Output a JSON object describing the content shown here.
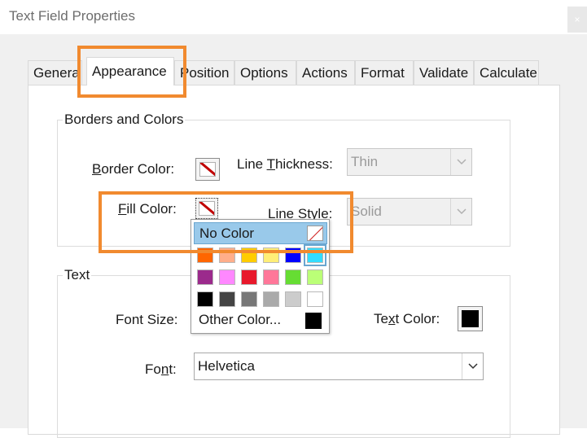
{
  "window": {
    "title": "Text Field Properties",
    "close_glyph": "×"
  },
  "tabs": [
    {
      "label": "General",
      "visible_text": "Genera"
    },
    {
      "label": "Appearance",
      "active": true
    },
    {
      "label": "Position"
    },
    {
      "label": "Options"
    },
    {
      "label": "Actions"
    },
    {
      "label": "Format"
    },
    {
      "label": "Validate"
    },
    {
      "label": "Calculate"
    }
  ],
  "borders_colors": {
    "group_label": "Borders and Colors",
    "border_color": {
      "mnemonic": "B",
      "rest": "order Color:"
    },
    "line_thickness": {
      "before": "Line ",
      "mnemonic": "T",
      "rest": "hickness:",
      "value": "Thin"
    },
    "fill_color": {
      "mnemonic": "F",
      "rest": "ill Color:"
    },
    "line_style": {
      "label": "Line Style:",
      "value": "Solid"
    }
  },
  "color_picker": {
    "no_color_label": "No Color",
    "other_color_label": "Other Color...",
    "other_color_swatch": "#000000",
    "colors": [
      [
        "#ff6600",
        "#ffae8a",
        "#ffcc00",
        "#ffee77",
        "#0000ff",
        "#33ddff"
      ],
      [
        "#9b2a8c",
        "#ff88ff",
        "#e8192c",
        "#ff7799",
        "#66dd33",
        "#bbff77"
      ],
      [
        "#000000",
        "#444444",
        "#777777",
        "#aaaaaa",
        "#cccccc",
        "#ffffff"
      ]
    ],
    "selected_cell": "#33ddff"
  },
  "text_section": {
    "group_label": "Text",
    "font_size_label": "Font Size:",
    "text_color": {
      "before": "Te",
      "mnemonic": "x",
      "rest": "t Color:",
      "value": "#000000"
    },
    "font_label": {
      "before": "Fo",
      "mnemonic": "n",
      "rest": "t:"
    },
    "font_value": "Helvetica"
  },
  "icons": {
    "chevron": "chevron-down-icon",
    "no_color_swatch": "no-color-swatch-icon"
  },
  "accent_colors": {
    "highlight": "#f18a2f",
    "menu_highlight": "#99c9ea"
  }
}
